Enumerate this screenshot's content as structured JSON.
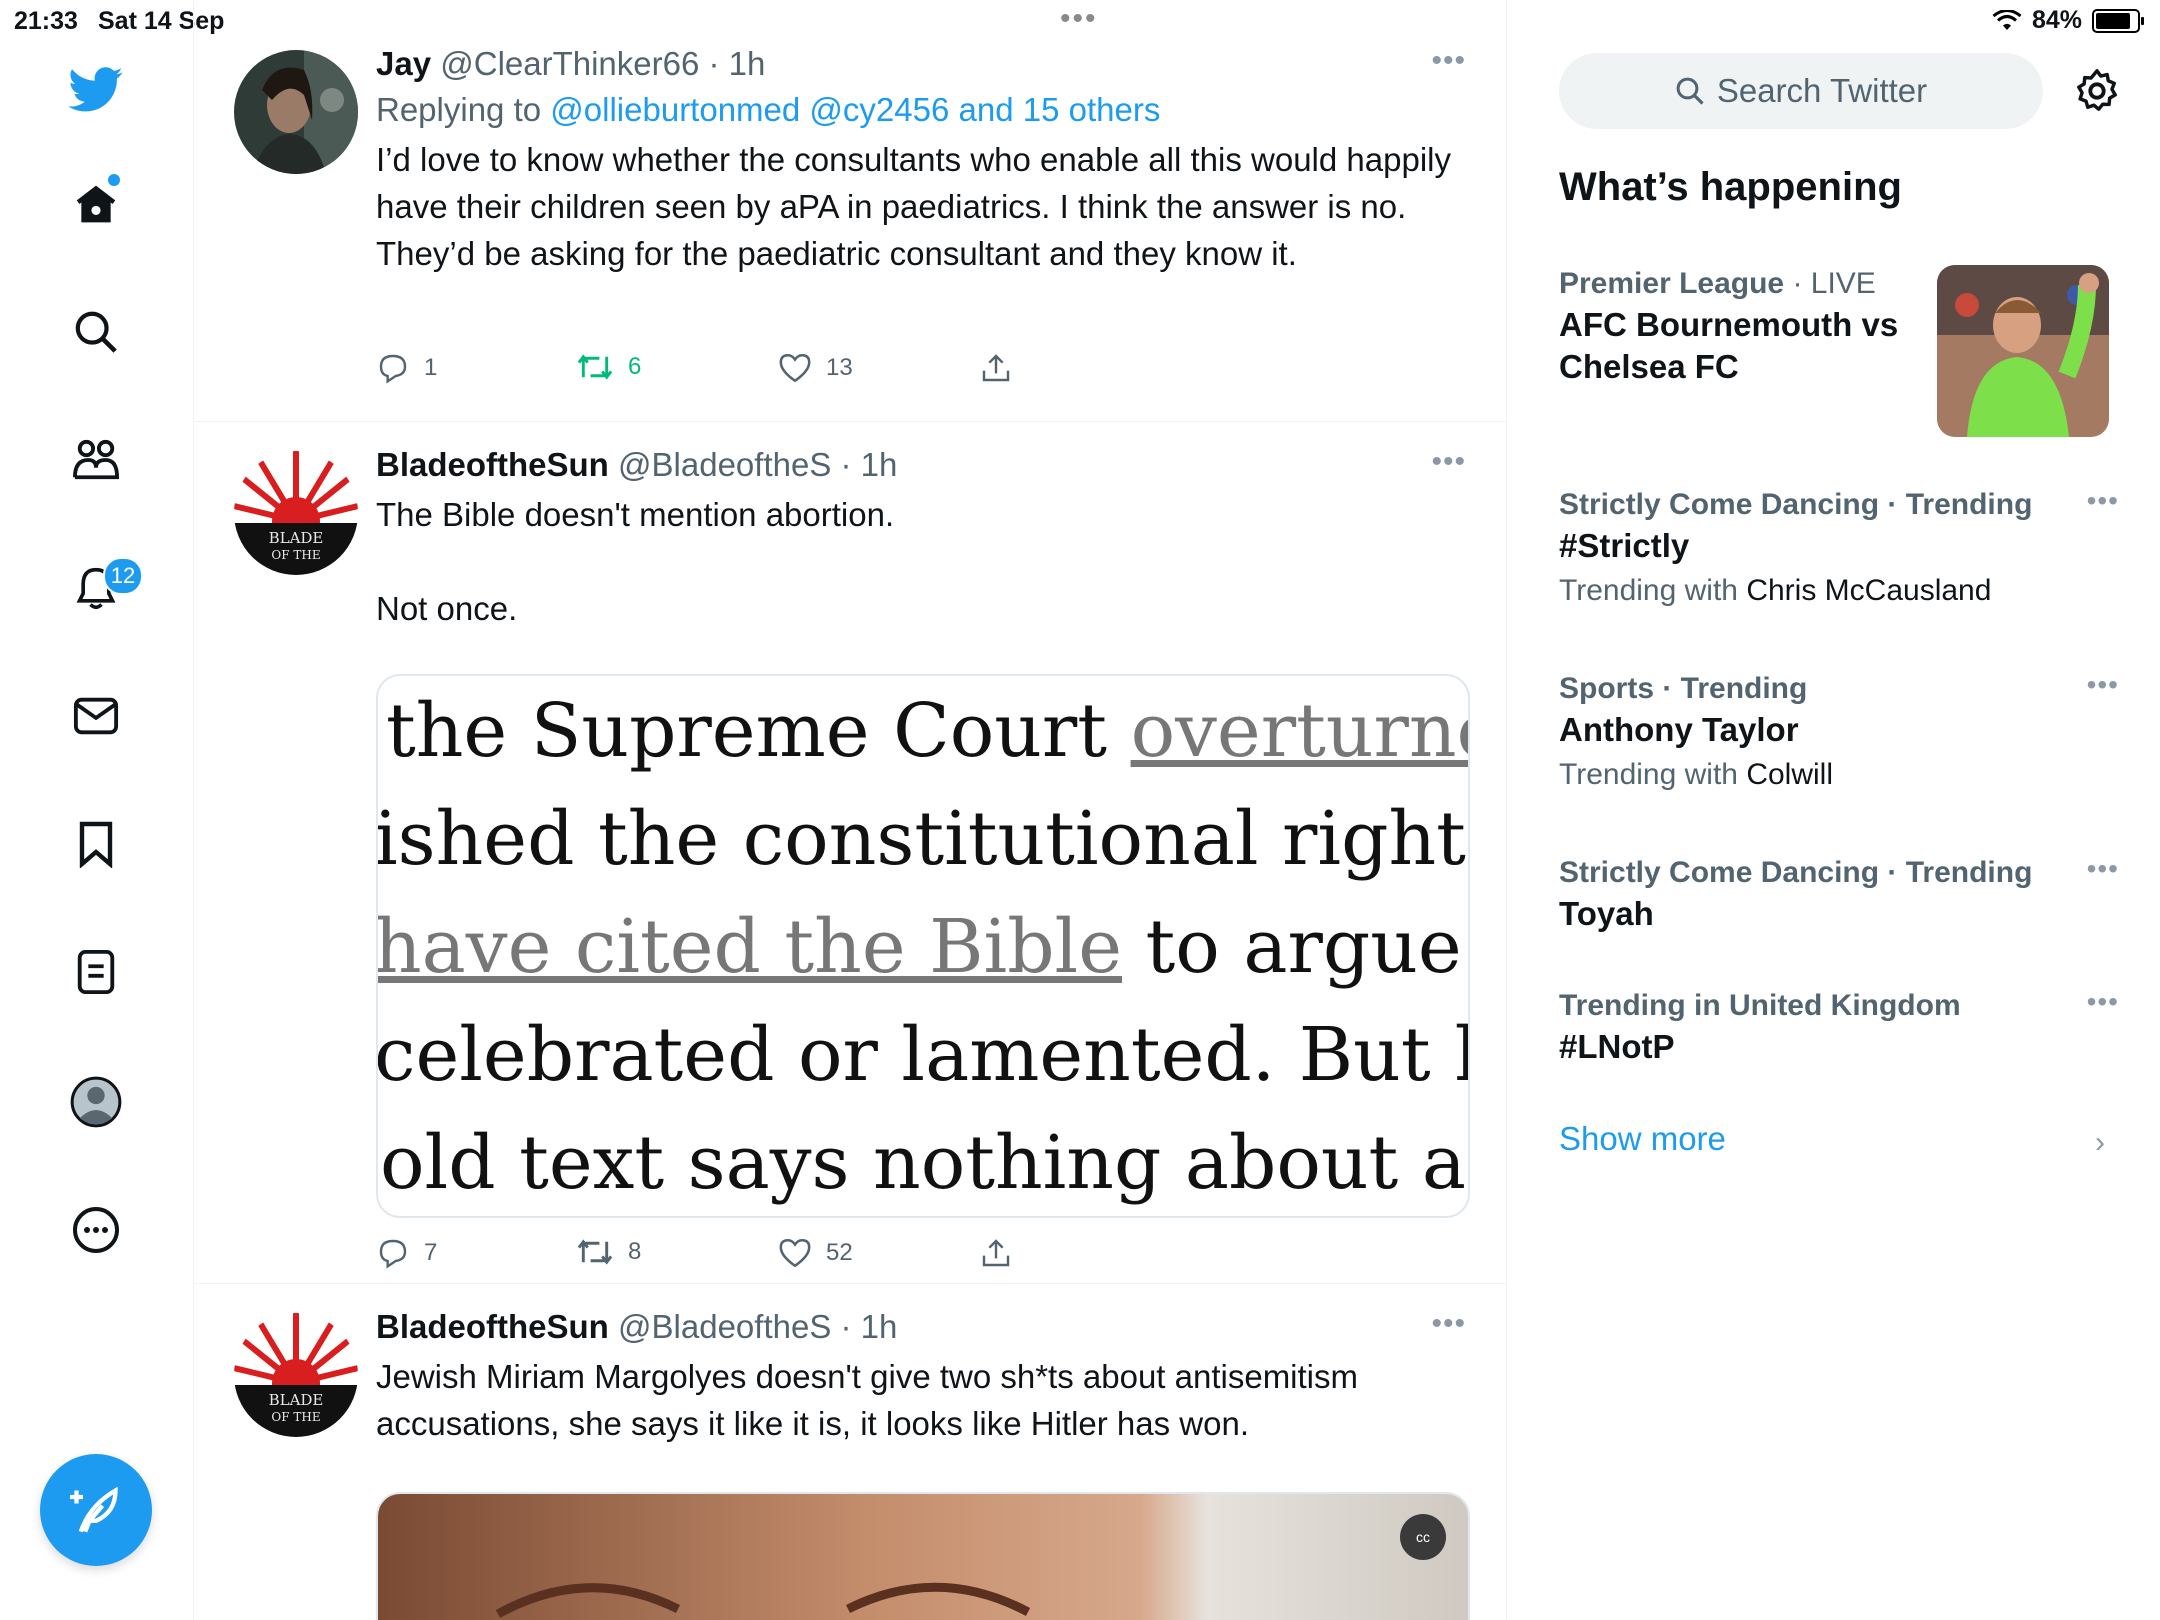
{
  "status_bar": {
    "time": "21:33",
    "date": "Sat 14 Sep",
    "battery": "84%"
  },
  "nav": {
    "notifications_badge": "12"
  },
  "tweets": [
    {
      "name": "Jay",
      "handle": "@ClearThinker66",
      "time": "· 1h",
      "replying_prefix": "Replying to",
      "replying_to": "@ollieburtonmed @cy2456 and 15 others",
      "text": "I’d love to know whether the consultants who enable all this would happily have their children seen by aPA in paediatrics. I think the answer is no. They’d be asking for the paediatric consultant and they know it.",
      "replies": "1",
      "retweets": "6",
      "likes": "13"
    },
    {
      "name": "BladeoftheSun",
      "handle": "@BladeoftheS",
      "time": "· 1h",
      "text": "The Bible doesn't mention abortion.\n\nNot once.",
      "media_lines": [
        {
          "plain": "the Supreme Court ",
          "link": "overturned"
        },
        {
          "plain": "ished the constitutional right to",
          "link": ""
        },
        {
          "link": "have cited the Bible",
          "plain": " to argue wh"
        },
        {
          "plain": "celebrated or lamented. But her",
          "link": ""
        },
        {
          "plain": "old text says nothing about abo",
          "link": ""
        }
      ],
      "replies": "7",
      "retweets": "8",
      "likes": "52"
    },
    {
      "name": "BladeoftheSun",
      "handle": "@BladeoftheS",
      "time": "· 1h",
      "text": "Jewish Miriam Margolyes doesn't give two sh*ts about antisemitism accusations, she says it like it is, it looks like Hitler has won.",
      "video_cc": "cc"
    }
  ],
  "sidebar": {
    "search_placeholder": "Search Twitter",
    "whats_happening": "What’s happening",
    "trends": [
      {
        "category": "Premier League",
        "live": " · LIVE",
        "title": "AFC Bournemouth vs Chelsea FC"
      },
      {
        "category": "Strictly Come Dancing · Trending",
        "title": "#Strictly",
        "with_prefix": "Trending with",
        "with": "Chris McCausland"
      },
      {
        "category": "Sports · Trending",
        "title": "Anthony Taylor",
        "with_prefix": "Trending with",
        "with": "Colwill"
      },
      {
        "category": "Strictly Come Dancing · Trending",
        "title": "Toyah"
      },
      {
        "category": "Trending in United Kingdom",
        "title": "#LNotP"
      }
    ],
    "show_more": "Show more"
  },
  "colors": {
    "accent": "#1d9bf0",
    "retweet_active": "#00ba7c",
    "muted": "#536471"
  }
}
